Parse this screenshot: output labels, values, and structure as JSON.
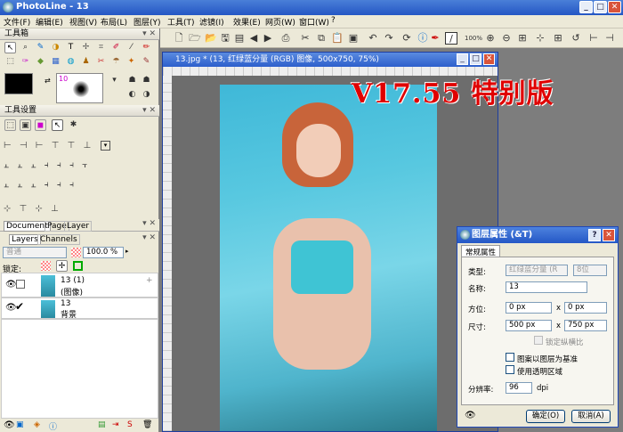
{
  "window": {
    "title": "PhotoLine - 13",
    "min": "_",
    "max": "□",
    "close": "✕"
  },
  "menu": [
    "文件(F)",
    "编辑(E)",
    "视图(V)",
    "布局(L)",
    "图层(Y)",
    "工具(T)",
    "滤镜(I)",
    "效果(E)",
    "网页(W)",
    "窗口(W)",
    "?"
  ],
  "toolbox": {
    "title": "工具箱",
    "brush_size": "10"
  },
  "tool_settings": {
    "title": "工具设置"
  },
  "layers_panel": {
    "tabs_top": [
      "Document",
      "Page",
      "Layer"
    ],
    "tabs": [
      "Layers",
      "Channels"
    ],
    "blend_mode": "普通",
    "opacity": "100.0 %",
    "lock_label": "锁定:",
    "layers": [
      {
        "name_line1": "13 (1)",
        "name_line2": "(图像)"
      },
      {
        "name_line1": "13",
        "name_line2": "背景"
      }
    ]
  },
  "toolbar": {
    "zoom_label": "100%"
  },
  "document": {
    "title": "13.jpg * (13, 红绿蓝分量 (RGB) 图像, 500x750, 75%)"
  },
  "banner": "V17.55 特别版",
  "dialog": {
    "title": "图层属性 (&T)",
    "tab": "常规属性",
    "type_label": "类型:",
    "type_value": "红绿蓝分量 (R",
    "type_bits": "8位",
    "name_label": "名称:",
    "name_value": "13",
    "offset_label": "方位:",
    "offset_x": "0 px",
    "offset_y": "0 px",
    "size_label": "尺寸:",
    "size_w": "500 px",
    "size_h": "750 px",
    "times": "x",
    "lock_ratio": "锁定纵横比",
    "pattern_base": "图案以图层为基准",
    "use_transparency": "使用透明区域",
    "resolution_label": "分辨率:",
    "resolution_value": "96",
    "resolution_unit": "dpi",
    "ok": "确定(O)",
    "cancel": "取消(A)"
  }
}
